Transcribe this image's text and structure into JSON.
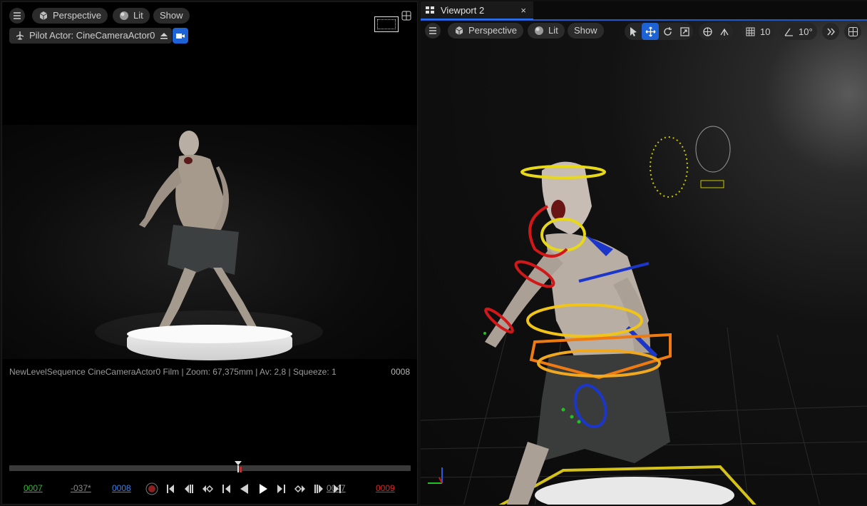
{
  "left_viewport": {
    "menu_icon": "hamburger-icon",
    "perspective_label": "Perspective",
    "lit_label": "Lit",
    "show_label": "Show",
    "pilot_label": "Pilot Actor: CineCameraActor0",
    "overlay_text": "NewLevelSequence CineCameraActor0 Film | Zoom: 67,375mm | Av: 2,8 | Squeeze: 1",
    "frame_label": "0008"
  },
  "transport": {
    "start_frame": "0007",
    "offset_value": "-037*",
    "current_frame": "0008",
    "end_value": "0047",
    "end_frame": "0009",
    "colors": {
      "start": "#37b337",
      "current": "#3f7fe0",
      "end": "#d42a2a",
      "offset": "#8a8a8a"
    }
  },
  "right_viewport": {
    "tab_title": "Viewport 2",
    "close_glyph": "×",
    "perspective_label": "Perspective",
    "lit_label": "Lit",
    "show_label": "Show",
    "grid_snap_value": "10",
    "rotation_snap_value": "10°"
  },
  "colors": {
    "accent": "#1d63d6",
    "background": "#0b0b0b",
    "pill": "#2b2b2b"
  }
}
